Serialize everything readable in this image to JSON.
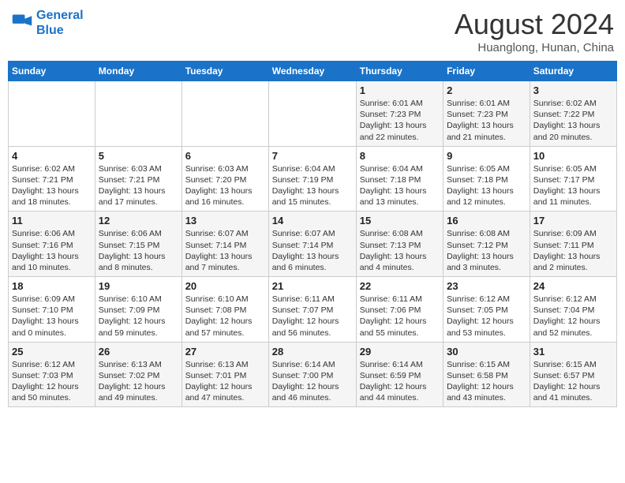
{
  "header": {
    "logo_line1": "General",
    "logo_line2": "Blue",
    "title": "August 2024",
    "subtitle": "Huanglong, Hunan, China"
  },
  "weekdays": [
    "Sunday",
    "Monday",
    "Tuesday",
    "Wednesday",
    "Thursday",
    "Friday",
    "Saturday"
  ],
  "weeks": [
    [
      {
        "day": "",
        "info": ""
      },
      {
        "day": "",
        "info": ""
      },
      {
        "day": "",
        "info": ""
      },
      {
        "day": "",
        "info": ""
      },
      {
        "day": "1",
        "info": "Sunrise: 6:01 AM\nSunset: 7:23 PM\nDaylight: 13 hours\nand 22 minutes."
      },
      {
        "day": "2",
        "info": "Sunrise: 6:01 AM\nSunset: 7:23 PM\nDaylight: 13 hours\nand 21 minutes."
      },
      {
        "day": "3",
        "info": "Sunrise: 6:02 AM\nSunset: 7:22 PM\nDaylight: 13 hours\nand 20 minutes."
      }
    ],
    [
      {
        "day": "4",
        "info": "Sunrise: 6:02 AM\nSunset: 7:21 PM\nDaylight: 13 hours\nand 18 minutes."
      },
      {
        "day": "5",
        "info": "Sunrise: 6:03 AM\nSunset: 7:21 PM\nDaylight: 13 hours\nand 17 minutes."
      },
      {
        "day": "6",
        "info": "Sunrise: 6:03 AM\nSunset: 7:20 PM\nDaylight: 13 hours\nand 16 minutes."
      },
      {
        "day": "7",
        "info": "Sunrise: 6:04 AM\nSunset: 7:19 PM\nDaylight: 13 hours\nand 15 minutes."
      },
      {
        "day": "8",
        "info": "Sunrise: 6:04 AM\nSunset: 7:18 PM\nDaylight: 13 hours\nand 13 minutes."
      },
      {
        "day": "9",
        "info": "Sunrise: 6:05 AM\nSunset: 7:18 PM\nDaylight: 13 hours\nand 12 minutes."
      },
      {
        "day": "10",
        "info": "Sunrise: 6:05 AM\nSunset: 7:17 PM\nDaylight: 13 hours\nand 11 minutes."
      }
    ],
    [
      {
        "day": "11",
        "info": "Sunrise: 6:06 AM\nSunset: 7:16 PM\nDaylight: 13 hours\nand 10 minutes."
      },
      {
        "day": "12",
        "info": "Sunrise: 6:06 AM\nSunset: 7:15 PM\nDaylight: 13 hours\nand 8 minutes."
      },
      {
        "day": "13",
        "info": "Sunrise: 6:07 AM\nSunset: 7:14 PM\nDaylight: 13 hours\nand 7 minutes."
      },
      {
        "day": "14",
        "info": "Sunrise: 6:07 AM\nSunset: 7:14 PM\nDaylight: 13 hours\nand 6 minutes."
      },
      {
        "day": "15",
        "info": "Sunrise: 6:08 AM\nSunset: 7:13 PM\nDaylight: 13 hours\nand 4 minutes."
      },
      {
        "day": "16",
        "info": "Sunrise: 6:08 AM\nSunset: 7:12 PM\nDaylight: 13 hours\nand 3 minutes."
      },
      {
        "day": "17",
        "info": "Sunrise: 6:09 AM\nSunset: 7:11 PM\nDaylight: 13 hours\nand 2 minutes."
      }
    ],
    [
      {
        "day": "18",
        "info": "Sunrise: 6:09 AM\nSunset: 7:10 PM\nDaylight: 13 hours\nand 0 minutes."
      },
      {
        "day": "19",
        "info": "Sunrise: 6:10 AM\nSunset: 7:09 PM\nDaylight: 12 hours\nand 59 minutes."
      },
      {
        "day": "20",
        "info": "Sunrise: 6:10 AM\nSunset: 7:08 PM\nDaylight: 12 hours\nand 57 minutes."
      },
      {
        "day": "21",
        "info": "Sunrise: 6:11 AM\nSunset: 7:07 PM\nDaylight: 12 hours\nand 56 minutes."
      },
      {
        "day": "22",
        "info": "Sunrise: 6:11 AM\nSunset: 7:06 PM\nDaylight: 12 hours\nand 55 minutes."
      },
      {
        "day": "23",
        "info": "Sunrise: 6:12 AM\nSunset: 7:05 PM\nDaylight: 12 hours\nand 53 minutes."
      },
      {
        "day": "24",
        "info": "Sunrise: 6:12 AM\nSunset: 7:04 PM\nDaylight: 12 hours\nand 52 minutes."
      }
    ],
    [
      {
        "day": "25",
        "info": "Sunrise: 6:12 AM\nSunset: 7:03 PM\nDaylight: 12 hours\nand 50 minutes."
      },
      {
        "day": "26",
        "info": "Sunrise: 6:13 AM\nSunset: 7:02 PM\nDaylight: 12 hours\nand 49 minutes."
      },
      {
        "day": "27",
        "info": "Sunrise: 6:13 AM\nSunset: 7:01 PM\nDaylight: 12 hours\nand 47 minutes."
      },
      {
        "day": "28",
        "info": "Sunrise: 6:14 AM\nSunset: 7:00 PM\nDaylight: 12 hours\nand 46 minutes."
      },
      {
        "day": "29",
        "info": "Sunrise: 6:14 AM\nSunset: 6:59 PM\nDaylight: 12 hours\nand 44 minutes."
      },
      {
        "day": "30",
        "info": "Sunrise: 6:15 AM\nSunset: 6:58 PM\nDaylight: 12 hours\nand 43 minutes."
      },
      {
        "day": "31",
        "info": "Sunrise: 6:15 AM\nSunset: 6:57 PM\nDaylight: 12 hours\nand 41 minutes."
      }
    ]
  ]
}
